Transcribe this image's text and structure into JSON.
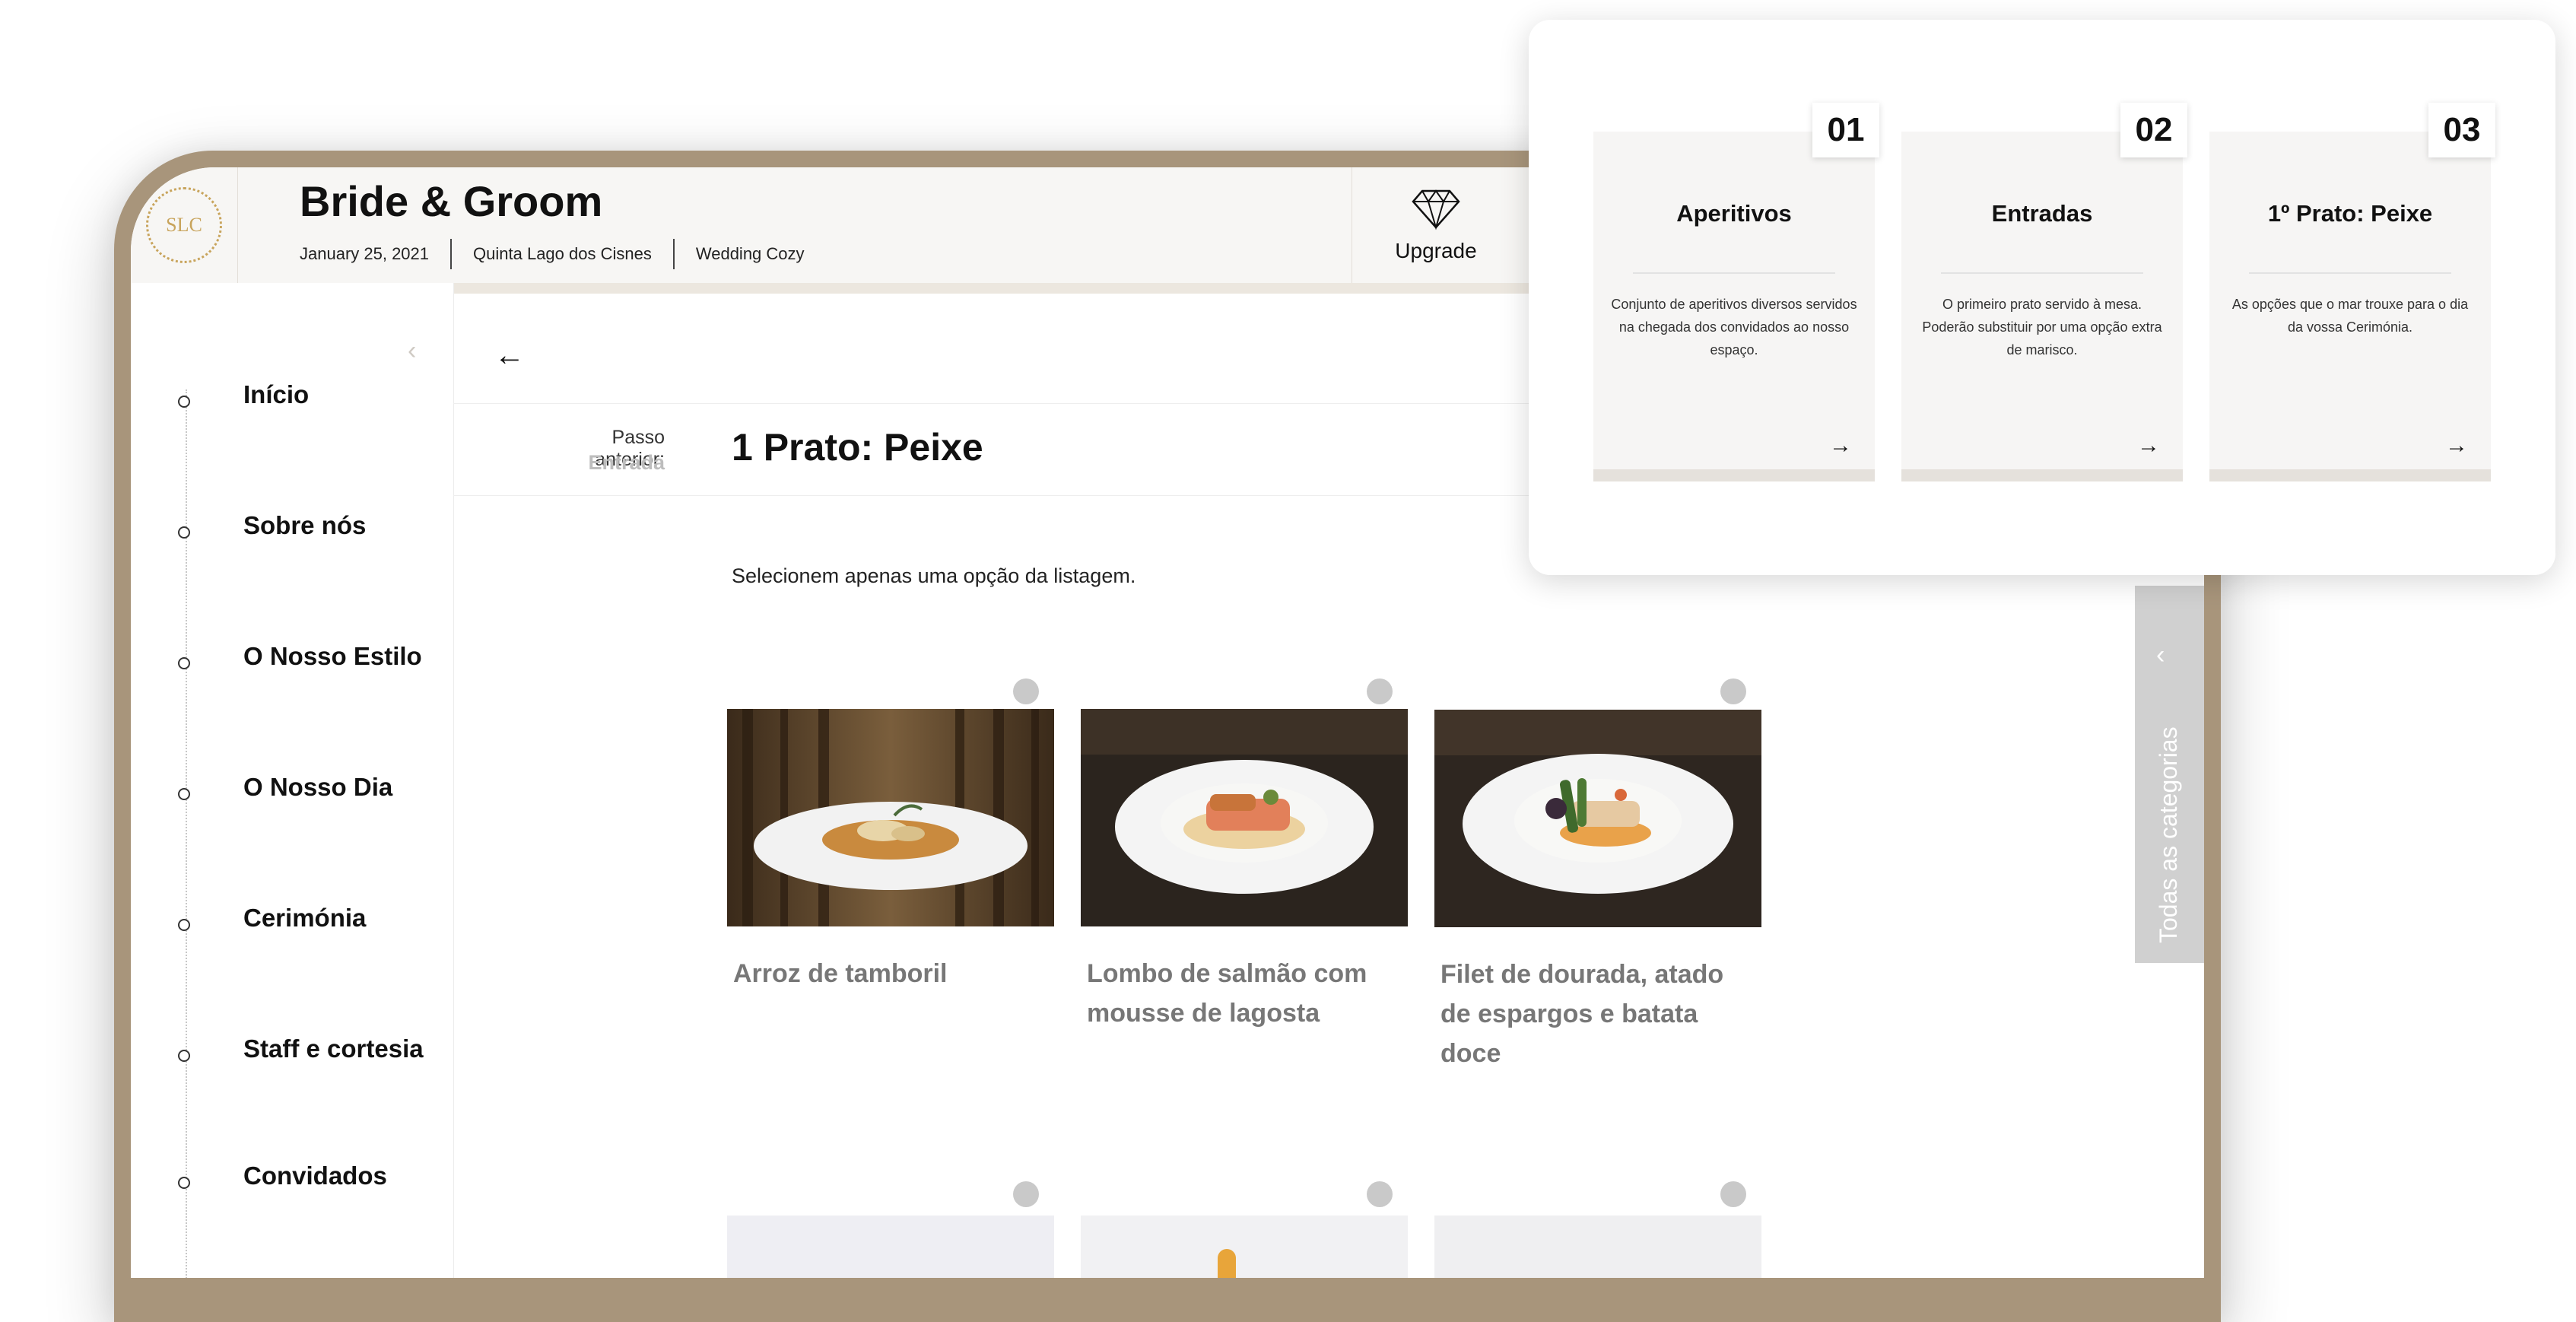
{
  "header": {
    "logo_text": "SLC",
    "couple_name": "Bride & Groom",
    "date": "January 25, 2021",
    "venue": "Quinta Lago dos Cisnes",
    "style": "Wedding Cozy",
    "upgrade_label": "Upgrade"
  },
  "sidebar": {
    "collapse_icon": "‹",
    "items": [
      {
        "label": "Início"
      },
      {
        "label": "Sobre nós"
      },
      {
        "label": "O Nosso Estilo"
      },
      {
        "label": "O Nosso Dia"
      },
      {
        "label": "Cerimónia"
      },
      {
        "label": "Staff e cortesia"
      },
      {
        "label": "Convidados"
      }
    ]
  },
  "main": {
    "back_icon": "←",
    "previous_step_label": "Passo anterior:",
    "previous_step_value": "Entrada",
    "step_title": "1 Prato: Peixe",
    "instruction": "Selecionem apenas uma opção da listagem.",
    "dishes": [
      {
        "name": "Arroz de tamboril"
      },
      {
        "name": "Lombo de salmão com mousse de lagosta"
      },
      {
        "name": "Filet de dourada, atado de espargos e batata doce"
      }
    ]
  },
  "category_tab": {
    "chevron": "‹",
    "label": "Todas as categorias"
  },
  "popup": {
    "categories": [
      {
        "number": "01",
        "title": "Aperitivos",
        "description": "Conjunto de aperitivos diversos servidos na chegada dos convidados ao nosso espaço."
      },
      {
        "number": "02",
        "title": "Entradas",
        "description": "O primeiro prato servido à mesa. Poderão substituir por uma opção extra de marisco."
      },
      {
        "number": "03",
        "title": "1º Prato: Peixe",
        "description": "As opções que o mar trouxe para o dia da vossa Cerimónia."
      }
    ],
    "arrow_icon": "→"
  },
  "colors": {
    "frame": "#a8957b",
    "gold": "#c8a45c",
    "muted_text": "#777777",
    "tab_gray": "#d0d0d0"
  }
}
